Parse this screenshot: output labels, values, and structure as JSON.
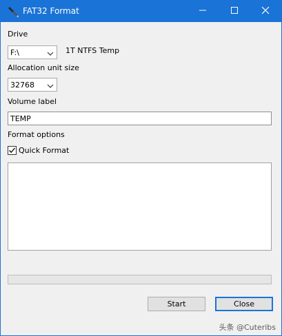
{
  "window": {
    "title": "FAT32 Format",
    "app_icon": "pen-icon",
    "controls": {
      "minimize": "minimize-icon",
      "maximize": "maximize-icon",
      "close": "close-icon"
    }
  },
  "drive": {
    "label": "Drive",
    "selected": "F:\\",
    "info": "1T NTFS Temp"
  },
  "allocation": {
    "label": "Allocation unit size",
    "selected": "32768"
  },
  "volume": {
    "label": "Volume label",
    "value": "TEMP"
  },
  "format_options": {
    "label": "Format options",
    "quick_format": {
      "label": "Quick Format",
      "checked": true
    }
  },
  "log": {
    "text": ""
  },
  "progress": {
    "fraction": 0
  },
  "buttons": {
    "start": "Start",
    "close": "Close"
  },
  "watermark": "头条 @Cuteribs",
  "colors": {
    "titlebar": "#1a73d6",
    "window_bg": "#f0f0f0",
    "accent_border": "#1a73d6"
  }
}
